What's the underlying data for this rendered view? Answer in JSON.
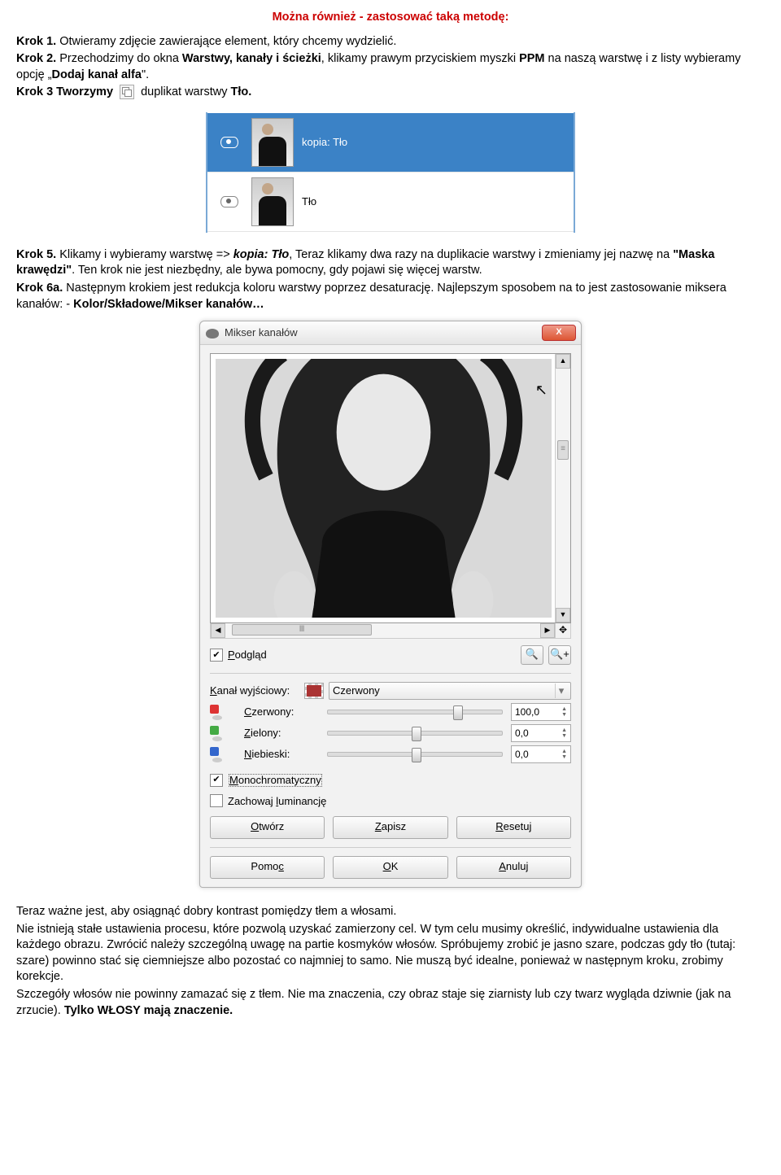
{
  "title": "Można również - zastosować taką metodę:",
  "step1": {
    "label": "Krok 1.",
    "text": " Otwieramy zdjęcie zawierające element, który chcemy wydzielić."
  },
  "step2": {
    "label": "Krok 2.",
    "t1": " Przechodzimy do okna ",
    "b1": "Warstwy, kanały i ścieżki",
    "t2": ", klikamy prawym przyciskiem myszki ",
    "b2": "PPM",
    "t3": " na naszą warstwę i z listy wybieramy opcję „",
    "b3": "Dodaj kanał alfa",
    "t4": "\"."
  },
  "step3": {
    "pre": "Krok 3 ",
    "tw": "Tworzymy",
    "post": " duplikat warstwy ",
    "bold": "Tło."
  },
  "layers": {
    "kopia": "kopia: Tło",
    "tlo": "Tło"
  },
  "step5": {
    "label": "Krok 5.",
    "t1": " Klikamy i wybieramy warstwę => ",
    "i1": "kopia: Tło",
    "t2": ", Teraz klikamy dwa razy na duplikacie warstwy i zmieniamy jej nazwę na ",
    "b1": "\"Maska krawędzi\"",
    "t3": ". Ten krok nie jest niezbędny, ale bywa pomocny, gdy pojawi się więcej warstw."
  },
  "step6": {
    "label": "Krok 6a.",
    "t1": " Następnym krokiem jest redukcja koloru warstwy poprzez desaturację. Najlepszym sposobem na to jest zastosowanie miksera kanałów: - ",
    "b1": "Kolor/Składowe/Mikser kanałów…"
  },
  "dialog": {
    "title": "Mikser kanałów",
    "close": "X",
    "preview_chk": "Podgląd",
    "output_label": "Kanał wyjściowy:",
    "output_value": "Czerwony",
    "red": "Czerwony:",
    "green": "Zielony:",
    "blue": "Niebieski:",
    "v_red": "100,0",
    "v_green": "0,0",
    "v_blue": "0,0",
    "mono": "Monochromatyczny",
    "lumi": "Zachowaj luminancję",
    "open": "Otwórz",
    "save": "Zapisz",
    "reset": "Resetuj",
    "help": "Pomoc",
    "ok": "OK",
    "cancel": "Anuluj"
  },
  "footer": {
    "p1": "Teraz ważne jest, aby osiągnąć dobry kontrast pomiędzy tłem a włosami.",
    "p2": "Nie istnieją stałe ustawienia procesu, które pozwolą uzyskać zamierzony cel. W tym celu musimy określić, indywidualne ustawienia dla każdego obrazu. Zwrócić należy szczególną uwagę na partie kosmyków włosów. Spróbujemy zrobić je jasno szare, podczas gdy tło (tutaj: szare) powinno stać się ciemniejsze albo pozostać co najmniej to samo. Nie muszą być idealne, ponieważ w następnym kroku, zrobimy korekcje.",
    "p3a": "Szczegóły włosów nie powinny zamazać się z tłem. Nie ma znaczenia, czy obraz staje się ziarnisty lub czy twarz wygląda dziwnie (jak na zrzucie). ",
    "p3b": "Tylko WŁOSY mają znaczenie."
  }
}
